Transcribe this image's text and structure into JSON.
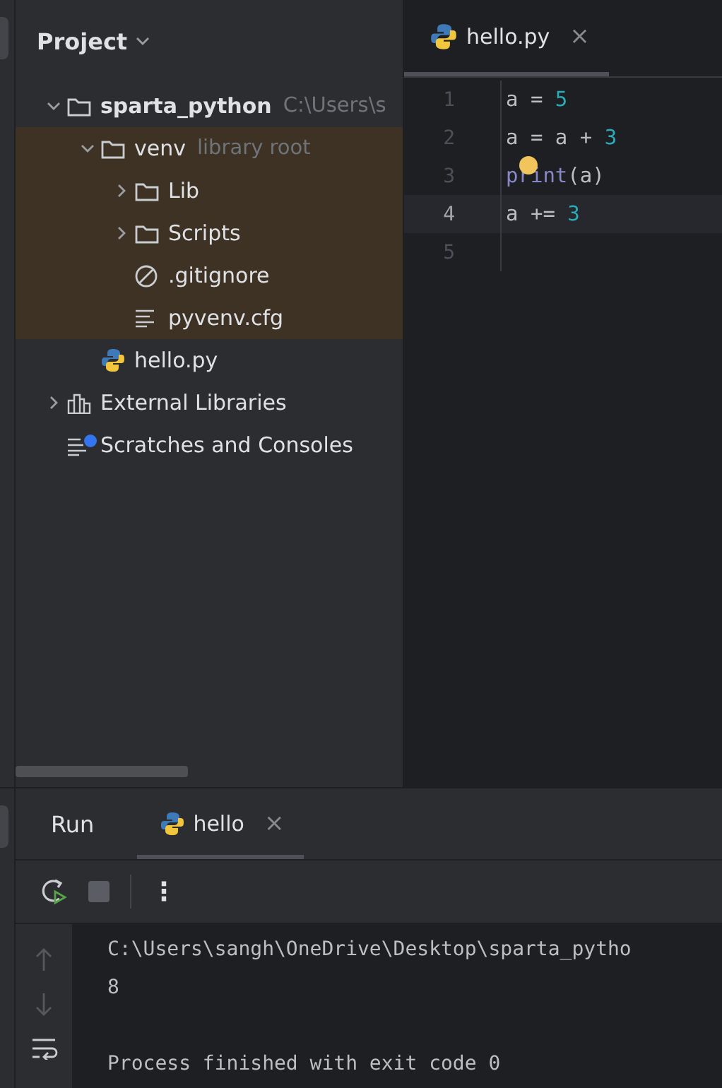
{
  "project_panel": {
    "title": "Project",
    "tree": [
      {
        "label": "sparta_python",
        "hint": "C:\\Users\\s",
        "kind": "folder",
        "bold": true,
        "expanded": true,
        "children": [
          {
            "label": "venv",
            "hint": "library root",
            "kind": "folder",
            "library": true,
            "expanded": true,
            "children": [
              {
                "label": "Lib",
                "kind": "folder",
                "expanded": false
              },
              {
                "label": "Scripts",
                "kind": "folder",
                "expanded": false
              },
              {
                "label": ".gitignore",
                "kind": "ignore"
              },
              {
                "label": "pyvenv.cfg",
                "kind": "text"
              }
            ]
          },
          {
            "label": "hello.py",
            "kind": "python"
          }
        ]
      },
      {
        "label": "External Libraries",
        "kind": "library",
        "expanded": false
      },
      {
        "label": "Scratches and Consoles",
        "kind": "scratches"
      }
    ]
  },
  "editor": {
    "tabs": [
      {
        "label": "hello.py",
        "selected": true,
        "close": "×"
      }
    ],
    "lines": [
      {
        "number": "1",
        "current": false,
        "tokens": [
          {
            "text": "a = ",
            "kind": "plain"
          },
          {
            "text": "5",
            "kind": "number"
          }
        ]
      },
      {
        "number": "2",
        "current": false,
        "tokens": [
          {
            "text": "a = a + ",
            "kind": "plain"
          },
          {
            "text": "3",
            "kind": "number"
          }
        ]
      },
      {
        "number": "3",
        "current": false,
        "bulb": true,
        "tokens": [
          {
            "text": "print",
            "kind": "builtin"
          },
          {
            "text": "(a)",
            "kind": "plain"
          }
        ]
      },
      {
        "number": "4",
        "current": true,
        "tokens": [
          {
            "text": "a += ",
            "kind": "plain"
          },
          {
            "text": "3",
            "kind": "number"
          }
        ]
      },
      {
        "number": "5",
        "current": false
      }
    ]
  },
  "run_panel": {
    "title": "Run",
    "tabs": [
      {
        "label": "hello",
        "selected": true,
        "close": "×"
      }
    ],
    "more": "⋮",
    "console": [
      {
        "text": "C:\\Users\\sangh\\OneDrive\\Desktop\\sparta_pytho"
      },
      {
        "text": "8"
      },
      {
        "text": "Process finished with exit code 0",
        "gap_before": true
      }
    ]
  }
}
